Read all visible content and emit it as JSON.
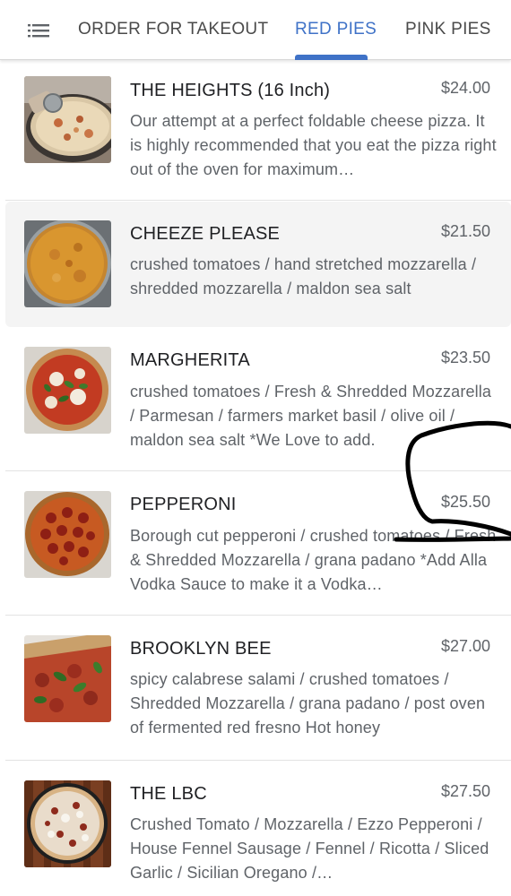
{
  "nav": {
    "menu_icon": "menu-icon",
    "tabs": [
      {
        "label": "ORDER FOR TAKEOUT",
        "active": false
      },
      {
        "label": "RED PIES",
        "active": true
      },
      {
        "label": "PINK PIES",
        "active": false
      }
    ],
    "active_color": "#3f72c7"
  },
  "menu_items": [
    {
      "name": "THE HEIGHTS (16 Inch)",
      "price": "$24.00",
      "description": "Our attempt at a perfect foldable cheese pizza. It is highly recommended that you eat the pizza right out of the oven for maximum…"
    },
    {
      "name": "CHEEZE PLEASE",
      "price": "$21.50",
      "description": "crushed tomatoes / hand stretched mozzarella / shredded mozzarella / maldon sea salt"
    },
    {
      "name": "MARGHERITA",
      "price": "$23.50",
      "description": "crushed tomatoes / Fresh & Shredded Mozzarella / Parmesan / farmers market basil / olive oil / maldon sea salt    *We Love to add."
    },
    {
      "name": "PEPPERONI",
      "price": "$25.50",
      "description": "Borough cut pepperoni / crushed tomatoes / Fresh & Shredded Mozzarella / grana padano *Add Alla Vodka Sauce to make it a Vodka…"
    },
    {
      "name": "BROOKLYN BEE",
      "price": "$27.00",
      "description": "spicy calabrese salami / crushed tomatoes / Shredded Mozzarella / grana padano / post oven of fermented red fresno Hot honey"
    },
    {
      "name": "THE LBC",
      "price": "$27.50",
      "description": "Crushed Tomato / Mozzarella / Ezzo Pepperoni / House Fennel Sausage / Fennel / Ricotta / Sliced Garlic / Sicilian Oregano /…"
    }
  ]
}
